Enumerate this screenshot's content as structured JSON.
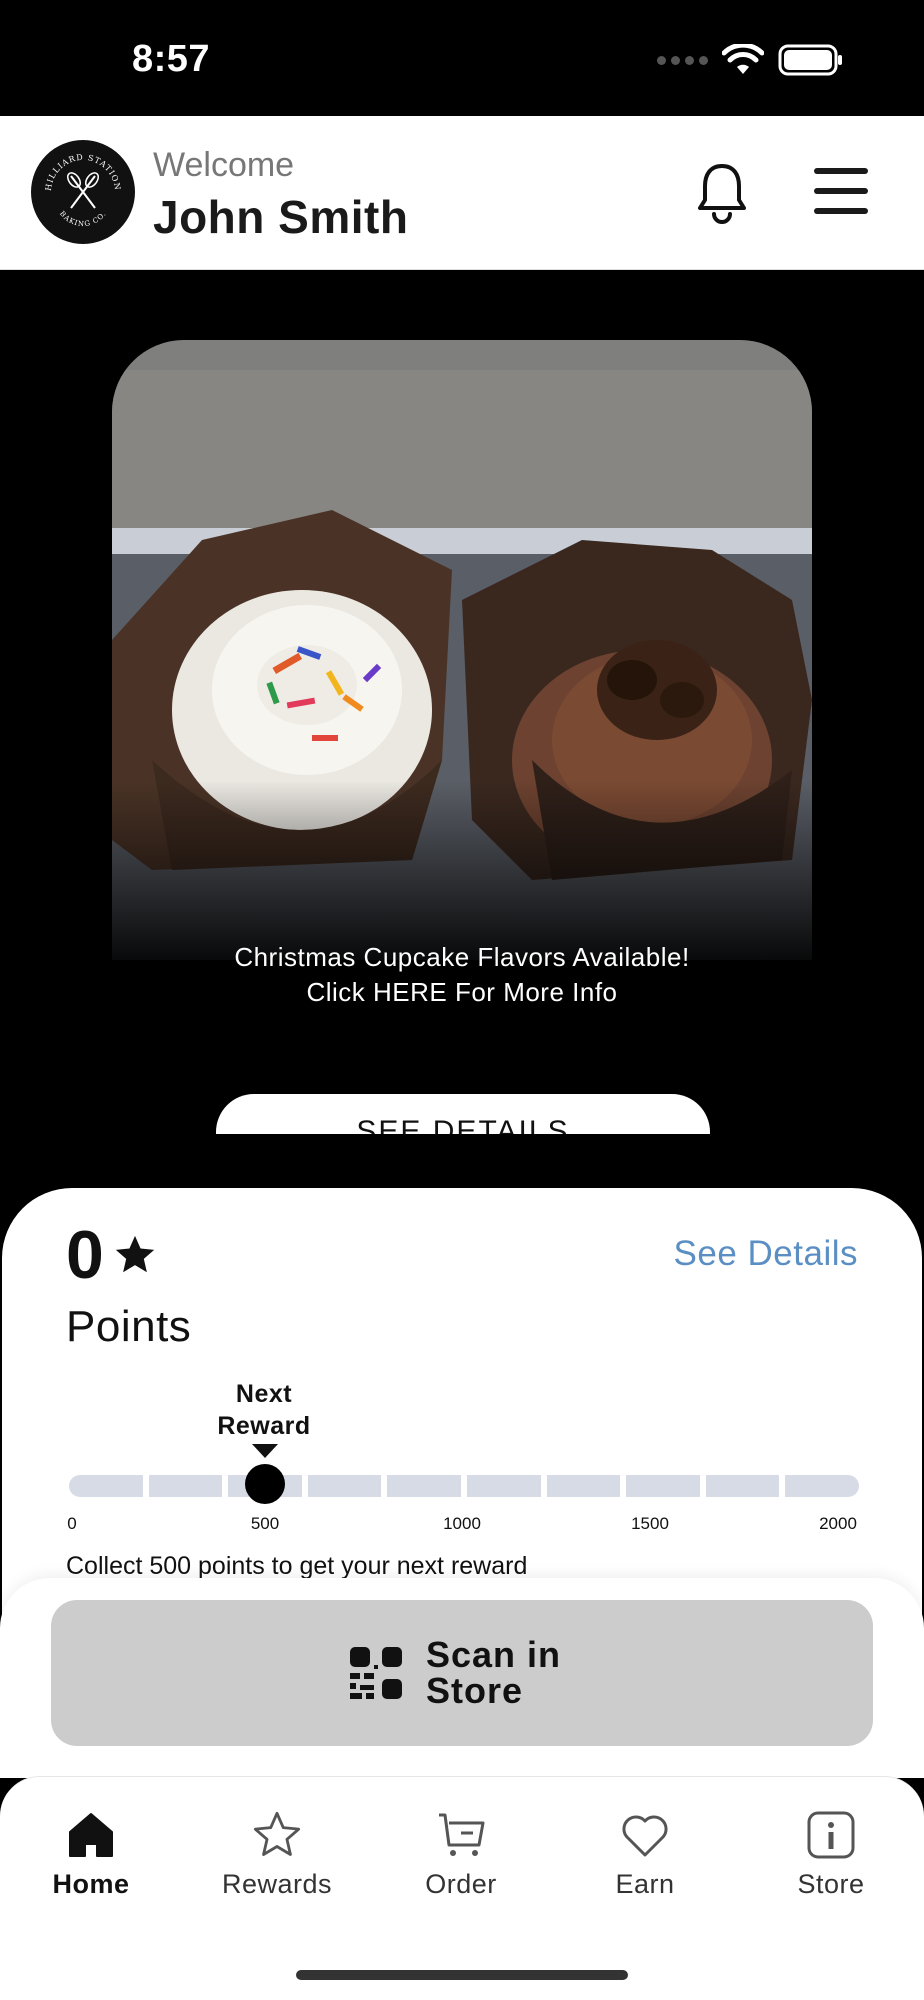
{
  "status_bar": {
    "time": "8:57"
  },
  "header": {
    "welcome": "Welcome",
    "user_name": "John Smith",
    "logo_text_top": "HILLIARD STATION",
    "logo_text_bottom": "BAKING CO."
  },
  "promo": {
    "line1": "Christmas Cupcake Flavors Available!",
    "line2": "Click HERE For More Info",
    "button_label": "SEE DETAILS"
  },
  "points": {
    "value": "0",
    "label": "Points",
    "see_details": "See Details",
    "next_reward_line1": "Next",
    "next_reward_line2": "Reward",
    "ticks": [
      "0",
      "500",
      "1000",
      "1500",
      "2000"
    ],
    "progress_max": 2000,
    "next_reward_at": 500,
    "collect_message": "Collect 500 points to get your next reward"
  },
  "scan": {
    "line1": "Scan in",
    "line2": "Store"
  },
  "tabs": [
    {
      "label": "Home",
      "icon": "home-icon",
      "active": true
    },
    {
      "label": "Rewards",
      "icon": "star-icon",
      "active": false
    },
    {
      "label": "Order",
      "icon": "cart-icon",
      "active": false
    },
    {
      "label": "Earn",
      "icon": "heart-icon",
      "active": false
    },
    {
      "label": "Store",
      "icon": "info-icon",
      "active": false
    }
  ]
}
